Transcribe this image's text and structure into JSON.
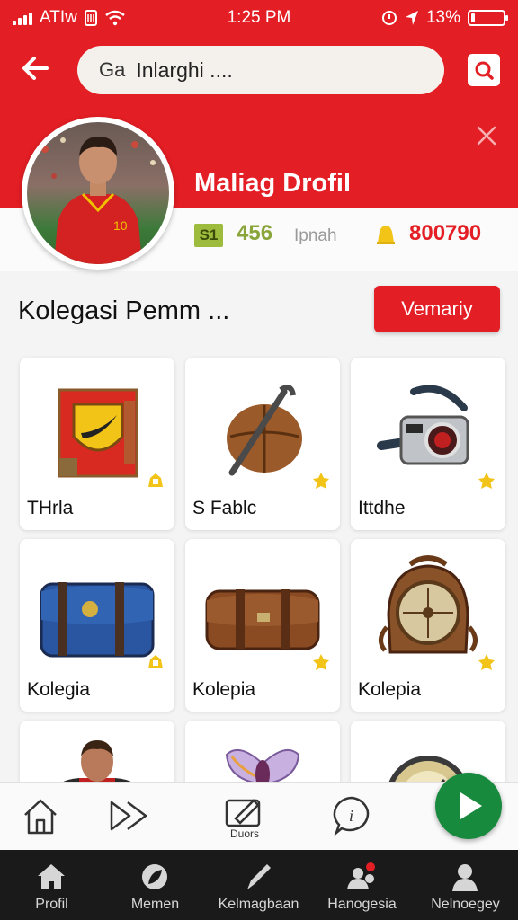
{
  "status_bar": {
    "carrier": "ATIw",
    "time": "1:25 PM",
    "battery_text": "13%",
    "battery_level": 0.13
  },
  "header": {
    "search_text": "Inlarghi ....",
    "search_prefix_icon": "Ga",
    "back_icon": "arrow-left-icon",
    "search_button_icon": "search-icon"
  },
  "profile": {
    "name": "Maliag Drofil",
    "stat1": {
      "badge": "S1",
      "value": "456",
      "unit": "Ipnah"
    },
    "stat2": {
      "value": "800790"
    }
  },
  "collection": {
    "title": "Kolegasi Pemm ...",
    "button_label": "Vemariy",
    "items": [
      {
        "label": "THrla",
        "art": "shield-banner"
      },
      {
        "label": "S Fablc",
        "art": "leather-ball-tool"
      },
      {
        "label": "Ittdhe",
        "art": "camera-device"
      },
      {
        "label": "Kolegia",
        "art": "blue-satchel"
      },
      {
        "label": "Kolepia",
        "art": "brown-bag"
      },
      {
        "label": "Kolepia",
        "art": "compass-backpack"
      },
      {
        "label": "",
        "art": "person"
      },
      {
        "label": "",
        "art": "butterfly"
      },
      {
        "label": "",
        "art": "gauge"
      }
    ]
  },
  "toolbar": {
    "items": [
      {
        "icon": "home-outline-icon"
      },
      {
        "icon": "fast-forward-icon"
      },
      {
        "icon": "edit-board-icon",
        "label": "Duors"
      },
      {
        "icon": "info-icon"
      }
    ],
    "fab_icon": "play-icon"
  },
  "bottom_nav": {
    "items": [
      {
        "label": "Profil",
        "icon": "home-icon"
      },
      {
        "label": "Memen",
        "icon": "leaf-icon"
      },
      {
        "label": "Kelmagbaan",
        "icon": "pen-icon"
      },
      {
        "label": "Hanogesia",
        "icon": "people-icon"
      },
      {
        "label": "Nelnoegey",
        "icon": "user-icon"
      }
    ]
  },
  "colors": {
    "brand_red": "#e31e24",
    "fab_green": "#188a3e",
    "nav_dark": "#1a1a1a",
    "badge_green": "#9dbb3c",
    "star_yellow": "#f2c418"
  }
}
